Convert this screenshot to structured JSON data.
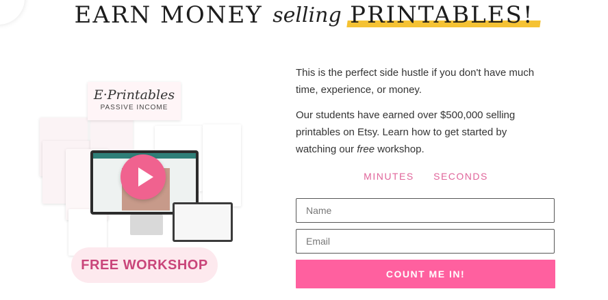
{
  "headline": {
    "part1": "EARN MONEY",
    "script_word": "selling",
    "part2": "PRINTABLES!"
  },
  "promo_image": {
    "cover_title": "E·Printables",
    "cover_subtitle": "PASSIVE INCOME",
    "badge_text": "FREE WORKSHOP"
  },
  "copy": {
    "paragraph1": "This is the perfect side hustle if you don't have much time, experience, or money.",
    "paragraph2_before": "Our students have earned over $500,000 selling printables on Etsy. Learn how to get started by watching our ",
    "paragraph2_emphasis": "free",
    "paragraph2_after": " workshop."
  },
  "timer": {
    "minutes_label": "MINUTES",
    "seconds_label": "SECONDS"
  },
  "form": {
    "name_placeholder": "Name",
    "email_placeholder": "Email",
    "submit_label": "COUNT ME IN!"
  },
  "colors": {
    "accent_pink": "#ff609f",
    "timer_pink": "#e0649a",
    "highlight_yellow": "#f5c233"
  }
}
